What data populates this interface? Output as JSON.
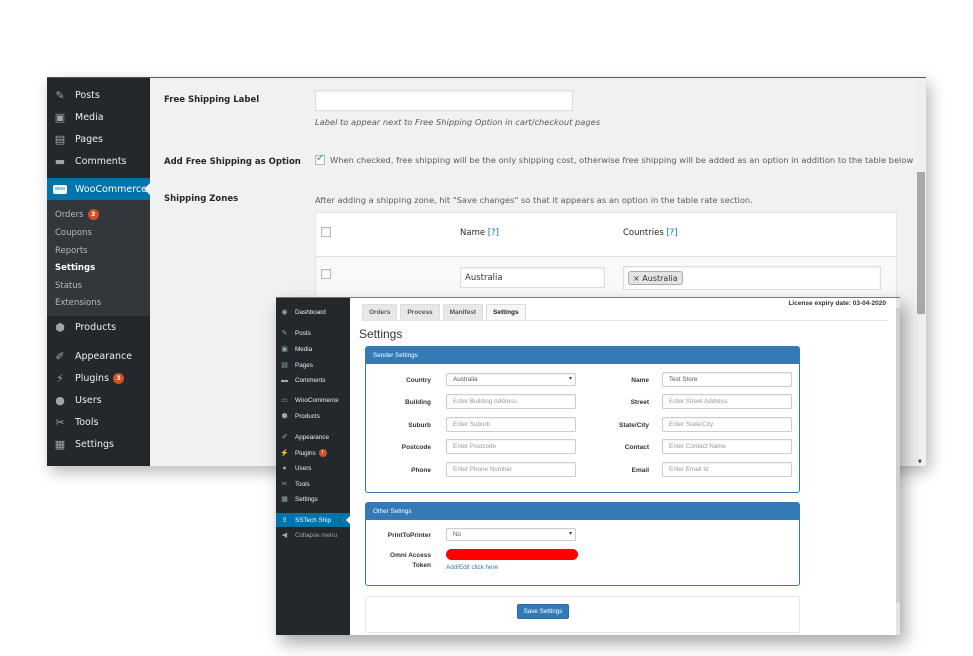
{
  "colors": {
    "wp_sidebar": "#23282d",
    "wp_active": "#0073aa",
    "panel_blue": "#337ab7",
    "badge": "#d54e21",
    "redaction": "#ff0000"
  },
  "back_window": {
    "sidebar": {
      "items": [
        {
          "label": "Posts",
          "icon": "pin-icon"
        },
        {
          "label": "Media",
          "icon": "media-icon"
        },
        {
          "label": "Pages",
          "icon": "pages-icon"
        },
        {
          "label": "Comments",
          "icon": "comment-icon"
        },
        {
          "label": "WooCommerce",
          "icon": "woo-icon",
          "active": true
        },
        {
          "label": "Products",
          "icon": "box-icon"
        },
        {
          "label": "Appearance",
          "icon": "brush-icon"
        },
        {
          "label": "Plugins",
          "icon": "plug-icon",
          "badge": "3"
        },
        {
          "label": "Users",
          "icon": "user-icon"
        },
        {
          "label": "Tools",
          "icon": "wrench-icon"
        },
        {
          "label": "Settings",
          "icon": "settings-icon"
        }
      ],
      "submenu": [
        {
          "label": "Orders",
          "badge": "3"
        },
        {
          "label": "Coupons"
        },
        {
          "label": "Reports"
        },
        {
          "label": "Settings",
          "current": true
        },
        {
          "label": "Status"
        },
        {
          "label": "Extensions"
        }
      ]
    },
    "form": {
      "free_shipping_label": {
        "label": "Free Shipping Label",
        "value": "",
        "description": "Label to appear next to Free Shipping Option in cart/checkout pages"
      },
      "add_free_shipping": {
        "label": "Add Free Shipping as Option",
        "checked": true,
        "description": "When checked, free shipping will be the only shipping cost, otherwise free shipping will be added as an option in addition to the table below"
      },
      "shipping_zones": {
        "label": "Shipping Zones",
        "description": "After adding a shipping zone, hit \"Save changes\" so that it appears as an option in the table rate section.",
        "columns": {
          "name": "Name",
          "countries": "Countries",
          "help": "[?]"
        },
        "rows": [
          {
            "name": "Australia",
            "countries": [
              "Australia"
            ],
            "chip_remove": "×"
          }
        ]
      }
    }
  },
  "front_window": {
    "sidebar": {
      "items": [
        {
          "label": "Dashboard",
          "icon": "dashboard-icon"
        },
        {
          "label": "Posts",
          "icon": "pin-icon"
        },
        {
          "label": "Media",
          "icon": "media-icon"
        },
        {
          "label": "Pages",
          "icon": "pages-icon"
        },
        {
          "label": "Comments",
          "icon": "comment-icon"
        },
        {
          "label": "WooCommerce",
          "icon": "woo-icon"
        },
        {
          "label": "Products",
          "icon": "box-icon"
        },
        {
          "label": "Appearance",
          "icon": "brush-icon"
        },
        {
          "label": "Plugins",
          "icon": "plug-icon",
          "badge": "!"
        },
        {
          "label": "Users",
          "icon": "user-icon"
        },
        {
          "label": "Tools",
          "icon": "wrench-icon"
        },
        {
          "label": "Settings",
          "icon": "settings-icon"
        },
        {
          "label": "SSTech Ship",
          "icon": "ship-upload-icon",
          "active": true
        },
        {
          "label": "Collapse menu",
          "icon": "collapse-icon"
        }
      ]
    },
    "tabs": [
      {
        "label": "Orders"
      },
      {
        "label": "Process"
      },
      {
        "label": "Manifest"
      },
      {
        "label": "Settings",
        "active": true
      }
    ],
    "license": "License expiry date: 03-04-2020",
    "title": "Settings",
    "sender_settings": {
      "heading": "Sender Settings",
      "left": [
        {
          "label": "Country",
          "type": "select",
          "value": "Australia"
        },
        {
          "label": "Building",
          "placeholder": "Enter Building Address",
          "value": ""
        },
        {
          "label": "Suburb",
          "placeholder": "Enter Suburb",
          "value": ""
        },
        {
          "label": "Postcode",
          "placeholder": "Enter Postcode",
          "value": ""
        },
        {
          "label": "Phone",
          "placeholder": "Enter Phone Number",
          "value": ""
        }
      ],
      "right": [
        {
          "label": "Name",
          "placeholder": "",
          "value": "Test Store"
        },
        {
          "label": "Street",
          "placeholder": "Enter Street Address",
          "value": ""
        },
        {
          "label": "State/City",
          "placeholder": "Enter State/City",
          "value": ""
        },
        {
          "label": "Contact",
          "placeholder": "Enter Contact Name",
          "value": ""
        },
        {
          "label": "Email",
          "placeholder": "Enter Email Id",
          "value": ""
        }
      ]
    },
    "other_settings": {
      "heading": "Other Setings",
      "print_to_printer": {
        "label": "PrintToPrinter",
        "value": "No"
      },
      "omni_token": {
        "label_line1": "Omni Access",
        "label_line2": "Token",
        "value_redacted": true,
        "link": "Add/Edit click here"
      }
    },
    "save_button": "Save Settings"
  }
}
